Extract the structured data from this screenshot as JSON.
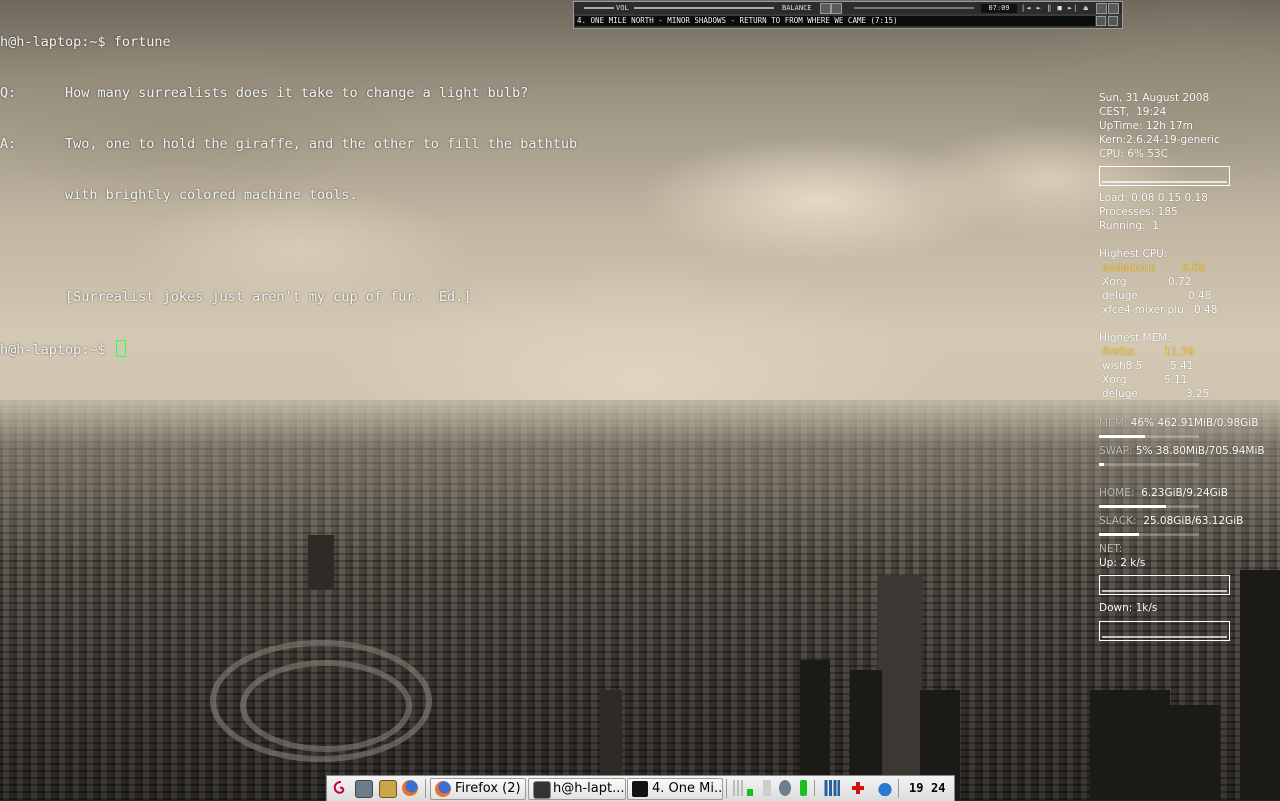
{
  "terminal": {
    "lines": [
      "h@h-laptop:~$ fortune",
      "Q:\tHow many surrealists does it take to change a light bulb?",
      "A:\tTwo, one to hold the giraffe, and the other to fill the bathtub",
      "\twith brightly colored machine tools.",
      "",
      "\t[Surrealist jokes just aren't my cup of fur.  Ed.]",
      "h@h-laptop:~$ "
    ]
  },
  "audacious": {
    "vol_label": "VOL",
    "balance_label": "BALANCE",
    "time": "07:09",
    "title": "4. ONE MILE NORTH - MINOR SHADOWS - RETURN TO FROM WHERE WE CAME (7:15)",
    "controls": "|◄ ► ‖ ■ ►| ⏏"
  },
  "conky": {
    "date": "Sun, 31 August 2008",
    "timezone": "CEST,",
    "time": "19:24",
    "uptime": "UpTime: 12h 17m",
    "kernel": "Kern:2.6.24-19-generic",
    "cpu": "CPU: 6% 53C",
    "load": "Load: 0.08 0.15 0.18",
    "processes": "Processes: 185",
    "running": "Running:  1",
    "highest_cpu_title": "Highest CPU:",
    "highest_cpu": [
      {
        "name": "audacious",
        "value": "0.00"
      },
      {
        "name": "Xorg",
        "value": "0.72"
      },
      {
        "name": "deluge",
        "value": "0.48"
      },
      {
        "name": "xfce4-mixer-plu",
        "value": "0.48"
      }
    ],
    "highest_mem_title": "Highest MEM:",
    "highest_mem": [
      {
        "name": "firefox",
        "value": "11.39"
      },
      {
        "name": "wish8.5",
        "value": "5.41"
      },
      {
        "name": "Xorg",
        "value": "5.11"
      },
      {
        "name": "deluge",
        "value": "3.25"
      }
    ],
    "mem_label": "MEM:",
    "mem_value": "46% 462.91MiB/0.98GiB",
    "mem_fraction": 0.46,
    "swap_label": "SWAP:",
    "swap_value": "5% 38.80MiB/705.94MiB",
    "swap_fraction": 0.05,
    "home_label": "HOME:",
    "home_value": "6.23GiB/9.24GiB",
    "home_fraction": 0.67,
    "slack_label": "SLACK:",
    "slack_value": "25.08GiB/63.12GiB",
    "slack_fraction": 0.4,
    "net_label": "NET:",
    "up": "Up: 2 k/s",
    "down": "Down: 1k/s",
    "accent_color": "#ffcc33"
  },
  "taskbar": {
    "tasks": [
      {
        "label": "Firefox (2)",
        "icon": "firefox-icon"
      },
      {
        "label": "h@h-lapt...",
        "icon": "terminal-icon"
      },
      {
        "label": "4. One Mi...",
        "icon": "audacious-icon"
      }
    ],
    "clock_hour": "19",
    "clock_min": "24"
  }
}
